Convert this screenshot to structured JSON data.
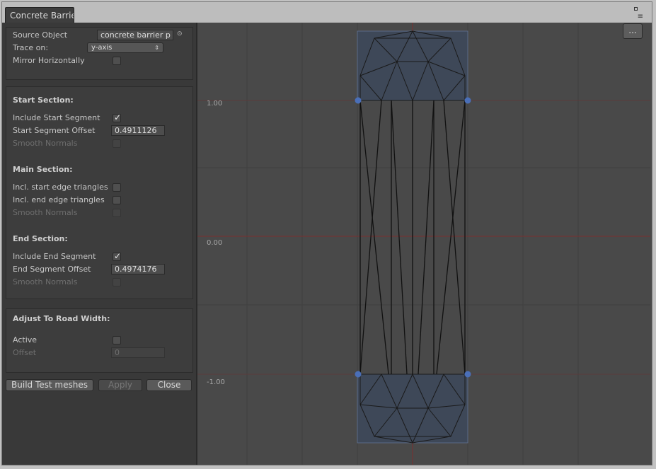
{
  "window": {
    "tab_title": "Concrete Barrier",
    "menu_icon": "≡",
    "maximize_icon": "□"
  },
  "source": {
    "label": "Source Object",
    "value": "concrete barrier p",
    "picker_icon": "⊙"
  },
  "trace": {
    "label": "Trace on:",
    "value": "y-axis",
    "arrows": "⇕"
  },
  "mirror": {
    "label": "Mirror Horizontally",
    "checked": false
  },
  "start_section": {
    "title": "Start Section:",
    "include_label": "Include Start Segment",
    "include_checked": true,
    "offset_label": "Start Segment Offset",
    "offset_value": "0.4911126",
    "smooth_label": "Smooth Normals",
    "smooth_checked": false
  },
  "main_section": {
    "title": "Main Section:",
    "start_edge_label": "Incl. start edge triangles",
    "end_edge_label": "Incl. end edge triangles",
    "smooth_label": "Smooth Normals"
  },
  "end_section": {
    "title": "End Section:",
    "include_label": "Include End Segment",
    "include_checked": true,
    "offset_label": "End Segment Offset",
    "offset_value": "0.4974176",
    "smooth_label": "Smooth Normals"
  },
  "adjust": {
    "title": "Adjust To Road Width:",
    "active_label": "Active",
    "active_checked": false,
    "offset_label": "Offset",
    "offset_value": "0"
  },
  "buttons": {
    "build": "Build Test meshes",
    "apply": "Apply",
    "close": "Close"
  },
  "viewport": {
    "options_label": "...",
    "y_ticks": [
      "1.00",
      "0.00",
      "-1.00"
    ],
    "colors": {
      "mesh_fill": "#3e4858",
      "axis": "#7a3030",
      "handle": "#4a6fb8"
    }
  }
}
